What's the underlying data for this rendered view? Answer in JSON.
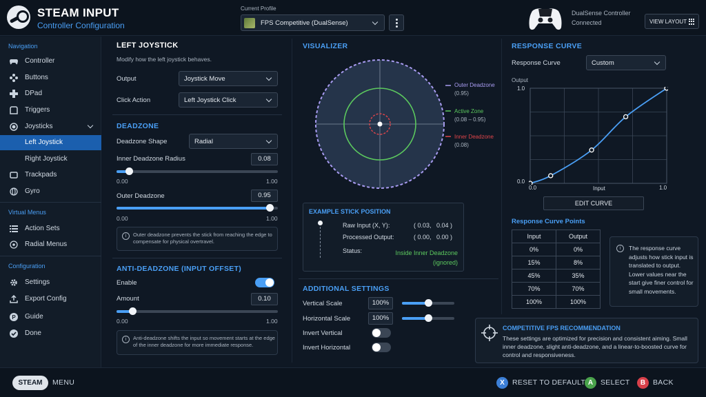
{
  "header": {
    "title": "STEAM INPUT",
    "subtitle": "Controller Configuration",
    "profile_label": "Current Profile",
    "profile_value": "FPS Competitive (DualSense)",
    "controller_name": "DualSense Controller",
    "controller_status": "Connected",
    "view_layout": "VIEW LAYOUT"
  },
  "sidebar": {
    "nav_heading": "Navigation",
    "items": [
      {
        "label": "Controller",
        "icon": "gamepad-icon"
      },
      {
        "label": "Buttons",
        "icon": "buttons-icon"
      },
      {
        "label": "DPad",
        "icon": "dpad-icon"
      },
      {
        "label": "Triggers",
        "icon": "trigger-icon"
      },
      {
        "label": "Joysticks",
        "icon": "joystick-icon"
      },
      {
        "label": "Left Joystick"
      },
      {
        "label": "Right Joystick"
      },
      {
        "label": "Trackpads",
        "icon": "trackpad-icon"
      },
      {
        "label": "Gyro",
        "icon": "gyro-icon"
      }
    ],
    "virtual_heading": "Virtual Menus",
    "virtual_items": [
      {
        "label": "Action Sets",
        "icon": "list-icon"
      },
      {
        "label": "Radial Menus",
        "icon": "radial-icon"
      }
    ],
    "config_heading": "Configuration",
    "config_items": [
      {
        "label": "Settings",
        "icon": "gear-icon"
      },
      {
        "label": "Export Config",
        "icon": "export-icon"
      },
      {
        "label": "Guide",
        "icon": "guide-icon"
      },
      {
        "label": "Done",
        "icon": "check-icon"
      }
    ]
  },
  "left_joystick": {
    "title": "LEFT JOYSTICK",
    "description": "Modify how the left joystick behaves.",
    "output_label": "Output",
    "output_value": "Joystick Move",
    "click_label": "Click Action",
    "click_value": "Left Joystick Click"
  },
  "deadzone": {
    "title": "DEADZONE",
    "shape_label": "Deadzone Shape",
    "shape_value": "Radial",
    "inner_label": "Inner Deadzone Radius",
    "inner_value": "0.08",
    "inner_fraction": 0.08,
    "inner_min": "0.00",
    "inner_max": "1.00",
    "outer_label": "Outer Deadzone",
    "outer_value": "0.95",
    "outer_fraction": 0.95,
    "outer_min": "0.00",
    "outer_max": "1.00",
    "note": "Outer deadzone prevents the stick from reaching the edge to compensate for physical overtravel."
  },
  "anti_deadzone": {
    "title": "ANTI-DEADZONE (INPUT OFFSET)",
    "enable_label": "Enable",
    "enabled": true,
    "amount_label": "Amount",
    "amount_value": "0.10",
    "amount_fraction": 0.1,
    "amount_min": "0.00",
    "amount_max": "1.00",
    "note": "Anti-deadzone shifts the input so movement starts at the edge of the inner deadzone for more immediate response."
  },
  "visualizer": {
    "title": "VISUALIZER",
    "outer_label": "Outer Deadzone",
    "outer_value": "(0.95)",
    "active_label": "Active Zone",
    "active_value": "(0.08 – 0.95)",
    "inner_label": "Inner Deadzone",
    "inner_value": "(0.08)",
    "colors": {
      "outer": "#a99cf2",
      "active": "#5cc95e",
      "inner": "#e0454a"
    }
  },
  "example": {
    "title": "EXAMPLE STICK POSITION",
    "raw_label": "Raw Input (X, Y):",
    "raw_value": "( 0.03,   0.04 )",
    "processed_label": "Processed Output:",
    "processed_value": "( 0.00,   0.00 )",
    "status_label": "Status:",
    "status_value": "Inside Inner Deadzone",
    "status_sub": "(ignored)"
  },
  "additional": {
    "title": "ADDITIONAL SETTINGS",
    "vscale_label": "Vertical Scale",
    "vscale_value": "100%",
    "vscale_fraction": 0.5,
    "hscale_label": "Horizontal Scale",
    "hscale_value": "100%",
    "hscale_fraction": 0.5,
    "invert_v_label": "Invert Vertical",
    "invert_v": false,
    "invert_h_label": "Invert Horizontal",
    "invert_h": false
  },
  "response": {
    "title": "RESPONSE CURVE",
    "curve_label": "Response Curve",
    "curve_value": "Custom",
    "y_label": "Output",
    "x_label": "Input",
    "y_max": "1.0",
    "y_min": "0.0",
    "x_min": "0.0",
    "x_max": "1.0",
    "edit_button": "EDIT CURVE",
    "points_title": "Response Curve Points",
    "col_input": "Input",
    "col_output": "Output",
    "points": [
      {
        "input": "0%",
        "output": "0%",
        "x": 0.0,
        "y": 0.0
      },
      {
        "input": "15%",
        "output": "8%",
        "x": 0.15,
        "y": 0.08
      },
      {
        "input": "45%",
        "output": "35%",
        "x": 0.45,
        "y": 0.35
      },
      {
        "input": "70%",
        "output": "70%",
        "x": 0.7,
        "y": 0.7
      },
      {
        "input": "100%",
        "output": "100%",
        "x": 1.0,
        "y": 1.0
      }
    ],
    "info": "The response curve adjusts how stick input is translated to output. Lower values near the start give finer control for small movements."
  },
  "recommendation": {
    "title": "COMPETITIVE FPS RECOMMENDATION",
    "text": "These settings are optimized for precision and consistent aiming. Small inner deadzone, slight anti-deadzone, and a linear-to-boosted curve for control and responsiveness."
  },
  "footer": {
    "steam": "STEAM",
    "menu": "MENU",
    "reset_key": "X",
    "reset": "RESET TO DEFAULT",
    "select_key": "A",
    "select": "SELECT",
    "back_key": "B",
    "back": "BACK"
  }
}
